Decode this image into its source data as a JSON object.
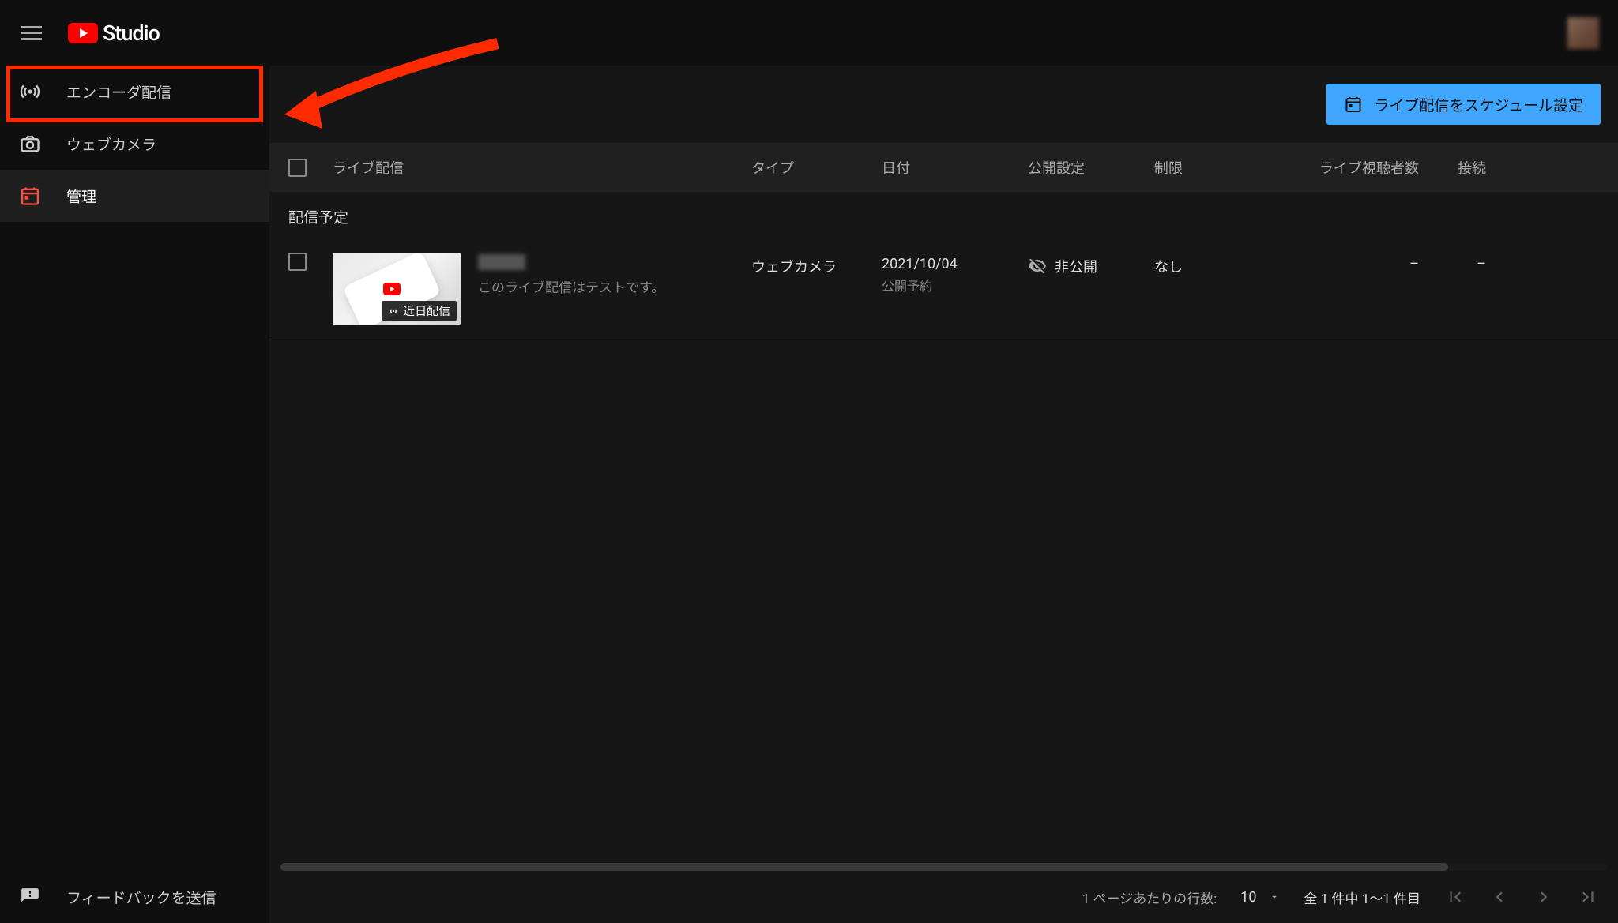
{
  "header": {
    "logo_text": "Studio"
  },
  "sidebar": {
    "items": [
      {
        "id": "encoder",
        "label": "エンコーダ配信"
      },
      {
        "id": "webcam",
        "label": "ウェブカメラ"
      },
      {
        "id": "manage",
        "label": "管理"
      }
    ],
    "feedback_label": "フィードバックを送信"
  },
  "topbar": {
    "schedule_label": "ライブ配信をスケジュール設定"
  },
  "table": {
    "headers": {
      "stream": "ライブ配信",
      "type": "タイプ",
      "date": "日付",
      "visibility": "公開設定",
      "restrict": "制限",
      "viewers": "ライブ視聴者数",
      "connect": "接続"
    },
    "section_title": "配信予定",
    "rows": [
      {
        "thumb_badge": "近日配信",
        "description": "このライブ配信はテストです。",
        "type": "ウェブカメラ",
        "date": "2021/10/04",
        "date_sub": "公開予約",
        "visibility": "非公開",
        "restrict": "なし",
        "viewers": "–",
        "connect": "–"
      }
    ]
  },
  "pagination": {
    "rows_label": "1 ページあたりの行数:",
    "rows_value": "10",
    "range": "全 1 件中 1～1 件目"
  }
}
